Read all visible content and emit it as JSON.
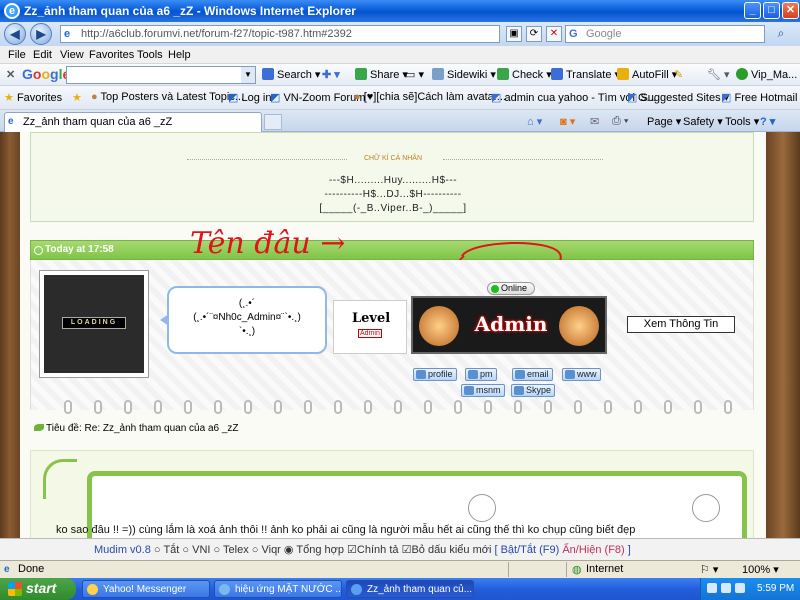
{
  "window": {
    "title": "Zz_ảnh tham quan của a6 _zZ - Windows Internet Explorer",
    "min": "_",
    "max": "□",
    "close": "✕"
  },
  "address": {
    "url": "http://a6club.forumvi.net/forum-f27/topic-t987.htm#2392",
    "search_placeholder": "Google"
  },
  "menu": [
    "File",
    "Edit",
    "View",
    "Favorites",
    "Tools",
    "Help"
  ],
  "google_toolbar": {
    "logo": "Google",
    "items": [
      "Search ▾",
      "Share ▾",
      "Sidewiki ▾",
      "Check ▾",
      "Translate ▾",
      "AutoFill ▾",
      "Vip_Ma..."
    ]
  },
  "favorites": {
    "label": "Favorites",
    "items": [
      "Top Posters và Latest Topic...",
      "Log in",
      "VN-Zoom Forum",
      "[♥][chia sẽ]Cách làm avatar...",
      "admin cua yahoo - Tìm với G...",
      "Suggested Sites ▾",
      "Free Hotmail"
    ]
  },
  "tab": {
    "label": "Zz_ảnh tham quan của a6 _zZ"
  },
  "commands": [
    "Page ▾",
    "Safety ▾",
    "Tools ▾"
  ],
  "post": {
    "sig_title": "CHỮ KÍ CÁ NHÂN",
    "sig_lines": [
      "---$H.........Huy.........H$---",
      "----------H$...DJ...$H----------",
      "[_____(-_B..Viper..B-_)_____]"
    ],
    "time": "Today at 17:58",
    "avatar_text": "LOADING",
    "bubble": [
      "(¸.•´",
      "(¸.•´¨¤Nh0c_Admin¤¨`•.¸)",
      "`•.¸)"
    ],
    "level_label": "Level",
    "level_sub": "Admin",
    "online": "Online",
    "rank": "Admin",
    "view_info": "Xem Thông Tin",
    "buttons": [
      "profile",
      "pm",
      "email",
      "www",
      "msnm",
      "Skype"
    ],
    "subject": "Tiêu đề: Re: Zz_ảnh tham quan của a6 _zZ",
    "message": "ko sao đâu !! =)) cùng lắm là xoá ảnh thôi !! ảnh ko phải ai cũng là người mẫu hết      ai cũng thế thì ko chụp cũng biết đẹp"
  },
  "annotation": "Tên đâu →",
  "mudim": {
    "version": "Mudim v0.8",
    "options": [
      "Tắt",
      "VNI",
      "Telex",
      "Viqr",
      "Tổng hợp"
    ],
    "checks": [
      "Chính tả",
      "Bỏ dấu kiểu mới"
    ],
    "toggle": "[ Bật/Tắt (F9)",
    "hide": "Ẩn/Hiện (F8)",
    "close_bracket": "]"
  },
  "status": {
    "text": "Done",
    "zone": "Internet",
    "zoom": "100% ▾"
  },
  "taskbar": {
    "start": "start",
    "tasks": [
      "Yahoo! Messenger",
      "hiệu ứng MẶT NƯỚC ...",
      "Zz_ảnh tham quan củ..."
    ],
    "clock": "5:59 PM"
  }
}
